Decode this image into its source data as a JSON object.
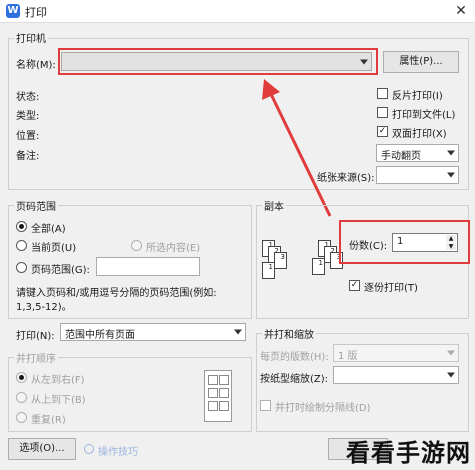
{
  "window": {
    "title": "打印",
    "app_icon": "W"
  },
  "printer": {
    "group_label": "打印机",
    "name_label": "名称(M):",
    "name_value": "",
    "properties_button": "属性(P)...",
    "status_label": "状态:",
    "type_label": "类型:",
    "location_label": "位置:",
    "comment_label": "备注:",
    "reverse_print": {
      "label": "反片打印(I)",
      "checked": false
    },
    "print_to_file": {
      "label": "打印到文件(L)",
      "checked": false
    },
    "duplex": {
      "label": "双面打印(X)",
      "checked": true
    },
    "duplex_mode": "手动翻页",
    "paper_source_label": "纸张来源(S):",
    "paper_source_value": ""
  },
  "page_range": {
    "group_label": "页码范围",
    "all": "全部(A)",
    "current": "当前页(U)",
    "selection": "所选内容(E)",
    "pages": "页码范围(G):",
    "pages_value": "",
    "hint_line1": "请键入页码和/或用逗号分隔的页码范围(例如:",
    "hint_line2": "1,3,5-12)。",
    "print_label": "打印(N):",
    "print_value": "范围中所有页面",
    "selected": "all"
  },
  "copies": {
    "group_label": "副本",
    "count_label": "份数(C):",
    "count_value": "1",
    "collate": {
      "label": "逐份打印(T)",
      "checked": true
    }
  },
  "merge": {
    "group_label": "并打顺序",
    "left_to_right": "从左到右(F)",
    "top_to_bottom": "从上到下(B)",
    "repeat": "重复(R)"
  },
  "zoom": {
    "group_label": "并打和缩放",
    "pages_per_sheet_label": "每页的版数(H):",
    "pages_per_sheet_value": "1 版",
    "scale_label": "按纸型缩放(Z):",
    "scale_value": "",
    "draw_lines": {
      "label": "并打时绘制分隔线(D)",
      "checked": false
    }
  },
  "footer": {
    "options_button": "选项(O)...",
    "tips_link": "操作技巧"
  },
  "watermark": "看看手游网",
  "colors": {
    "highlight": "#e03c3c",
    "accent": "#2f6fde"
  }
}
